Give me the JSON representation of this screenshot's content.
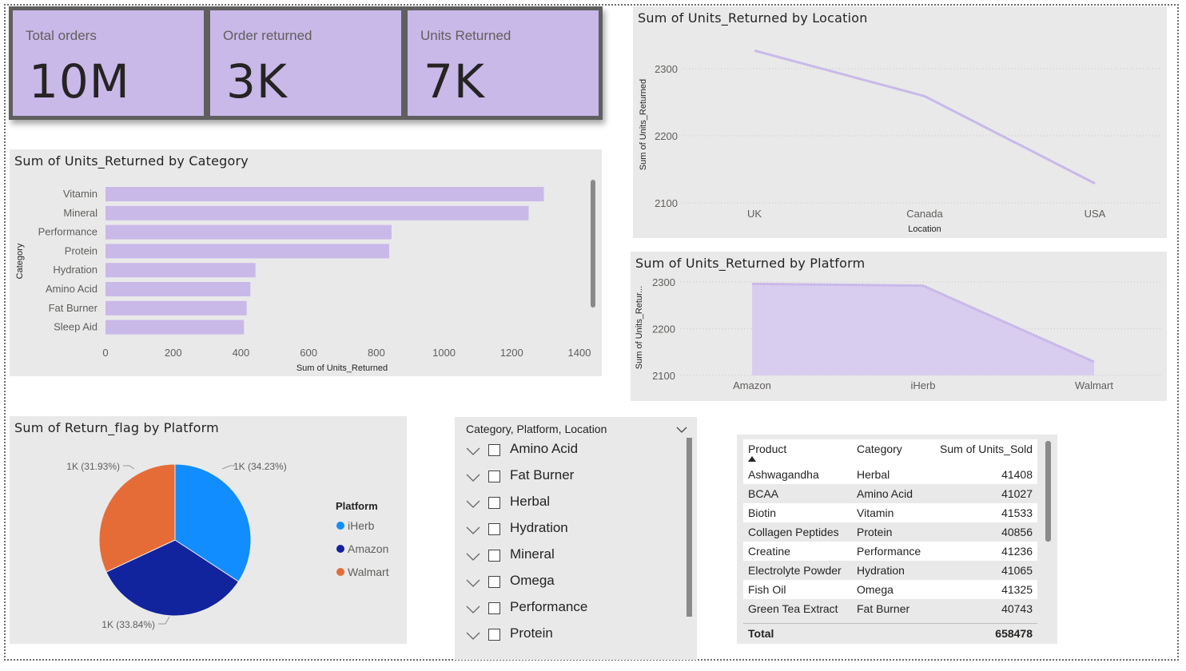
{
  "kpis": [
    {
      "label": "Total orders",
      "value": "10M"
    },
    {
      "label": "Order returned",
      "value": "3K"
    },
    {
      "label": "Units Returned",
      "value": "7K"
    }
  ],
  "colors": {
    "bar": "#c9b9e9",
    "line": "#c9b9e9",
    "iherb": "#118dff",
    "amazon": "#12239e",
    "walmart": "#e66c37",
    "panel": "#e9e9e9"
  },
  "category_chart": {
    "title": "Sum of Units_Returned by Category",
    "xlabel": "Sum of Units_Returned",
    "ylabel": "Category",
    "categories": [
      "Vitamin",
      "Mineral",
      "Performance",
      "Protein",
      "Hydration",
      "Amino Acid",
      "Fat Burner",
      "Sleep Aid"
    ],
    "values": [
      1295,
      1250,
      845,
      838,
      443,
      428,
      417,
      409
    ],
    "ticks": [
      "0",
      "200",
      "400",
      "600",
      "800",
      "1000",
      "1200",
      "1400"
    ]
  },
  "location_chart": {
    "title": "Sum of Units_Returned by Location",
    "xlabel": "Location",
    "ylabel": "Sum of Units_Returned",
    "categories": [
      "UK",
      "Canada",
      "USA"
    ],
    "values": [
      2327,
      2259,
      2129
    ],
    "ticks": [
      "2100",
      "2200",
      "2300"
    ]
  },
  "platform_area_chart": {
    "title": "Sum of Units_Returned by Platform",
    "ylabel": "Sum of Units_Retur...",
    "categories": [
      "Amazon",
      "iHerb",
      "Walmart"
    ],
    "values": [
      2296,
      2292,
      2129
    ],
    "ticks": [
      "2100",
      "2200",
      "2300"
    ]
  },
  "pie_chart": {
    "title": "Sum of Return_flag by Platform",
    "legend_title": "Platform",
    "legend": [
      "iHerb",
      "Amazon",
      "Walmart"
    ],
    "labels": [
      "1K (34.23%)",
      "1K (33.84%)",
      "1K (31.93%)"
    ],
    "percents": [
      34.23,
      33.84,
      31.93
    ]
  },
  "slicer": {
    "header": "Category, Platform, Location",
    "items": [
      "Amino Acid",
      "Fat Burner",
      "Herbal",
      "Hydration",
      "Mineral",
      "Omega",
      "Performance",
      "Protein"
    ]
  },
  "table": {
    "headers": [
      "Product",
      "Category",
      "Sum of Units_Sold"
    ],
    "rows": [
      [
        "Ashwagandha",
        "Herbal",
        "41408"
      ],
      [
        "BCAA",
        "Amino Acid",
        "41027"
      ],
      [
        "Biotin",
        "Vitamin",
        "41533"
      ],
      [
        "Collagen Peptides",
        "Protein",
        "40856"
      ],
      [
        "Creatine",
        "Performance",
        "41236"
      ],
      [
        "Electrolyte Powder",
        "Hydration",
        "41065"
      ],
      [
        "Fish Oil",
        "Omega",
        "41325"
      ],
      [
        "Green Tea Extract",
        "Fat Burner",
        "40743"
      ]
    ],
    "total_label": "Total",
    "total_value": "658478"
  },
  "chart_data": [
    {
      "type": "bar",
      "title": "Sum of Units_Returned by Category",
      "categories": [
        "Vitamin",
        "Mineral",
        "Performance",
        "Protein",
        "Hydration",
        "Amino Acid",
        "Fat Burner",
        "Sleep Aid"
      ],
      "values": [
        1295,
        1250,
        845,
        838,
        443,
        428,
        417,
        409
      ],
      "xlabel": "Sum of Units_Returned",
      "ylabel": "Category",
      "xlim": [
        0,
        1450
      ],
      "legend": "none"
    },
    {
      "type": "line",
      "title": "Sum of Units_Returned by Location",
      "categories": [
        "UK",
        "Canada",
        "USA"
      ],
      "values": [
        2327,
        2259,
        2129
      ],
      "xlabel": "Location",
      "ylabel": "Sum of Units_Returned",
      "ylim": [
        2090,
        2340
      ],
      "grid": true
    },
    {
      "type": "area",
      "title": "Sum of Units_Returned by Platform",
      "categories": [
        "Amazon",
        "iHerb",
        "Walmart"
      ],
      "values": [
        2296,
        2292,
        2129
      ],
      "ylabel": "Sum of Units_Retur...",
      "ylim": [
        2100,
        2300
      ],
      "grid": true
    },
    {
      "type": "pie",
      "title": "Sum of Return_flag by Platform",
      "categories": [
        "iHerb",
        "Amazon",
        "Walmart"
      ],
      "values": [
        34.23,
        33.84,
        31.93
      ],
      "legend": "right"
    }
  ]
}
